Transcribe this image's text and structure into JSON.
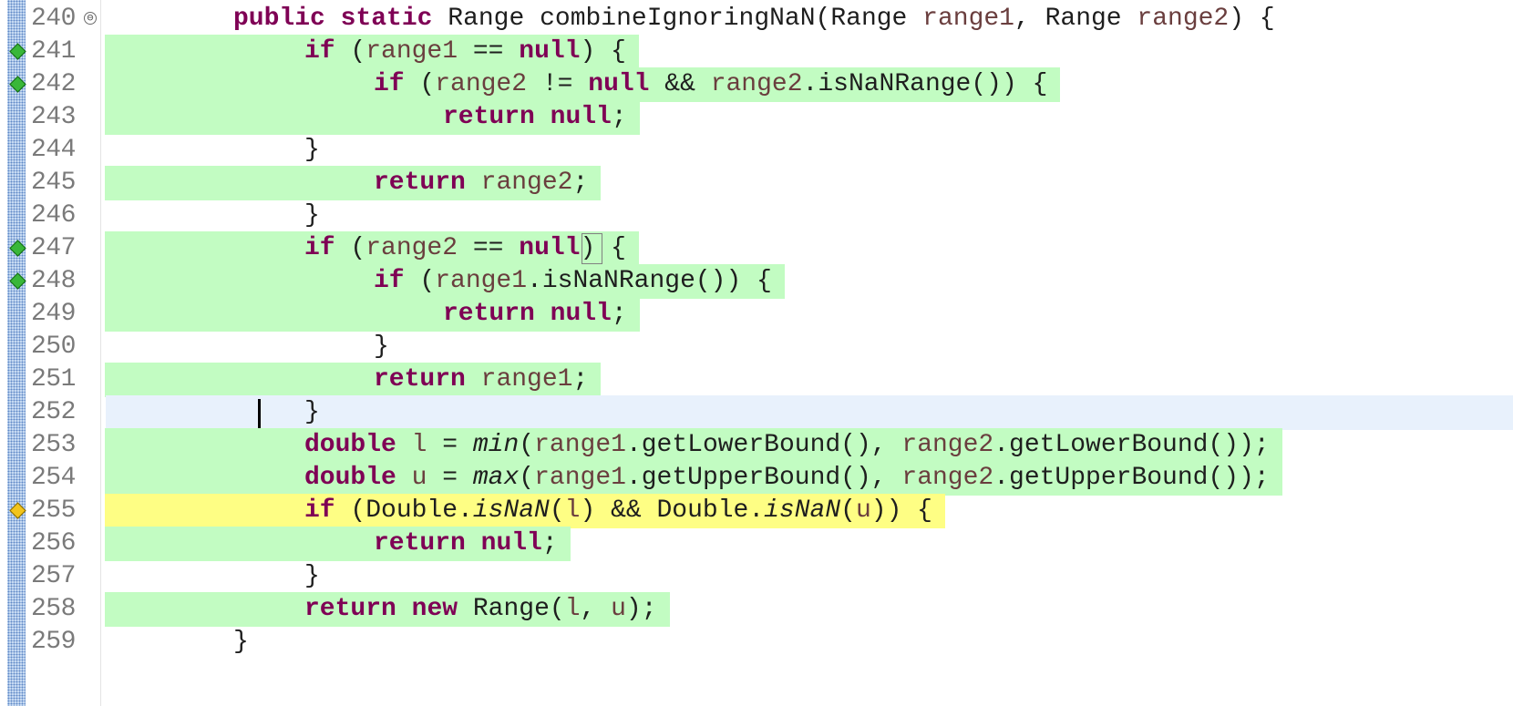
{
  "editor": {
    "lines": [
      {
        "number": "240",
        "fold": "⊖",
        "segments": [
          {
            "cls": "kw",
            "t": "public"
          },
          {
            "t": " "
          },
          {
            "cls": "kw",
            "t": "static"
          },
          {
            "t": " Range combineIgnoringNaN(Range "
          },
          {
            "cls": "par",
            "t": "range1"
          },
          {
            "t": ", Range "
          },
          {
            "cls": "par",
            "t": "range2"
          },
          {
            "t": ") {"
          }
        ]
      },
      {
        "number": "241",
        "marker": "covered",
        "highlight": "covered",
        "segments": [
          {
            "cls": "kw",
            "t": "if"
          },
          {
            "t": " ("
          },
          {
            "cls": "par",
            "t": "range1"
          },
          {
            "t": " == "
          },
          {
            "cls": "kw",
            "t": "null"
          },
          {
            "t": ") {"
          }
        ]
      },
      {
        "number": "242",
        "marker": "covered",
        "highlight": "covered",
        "segments": [
          {
            "cls": "kw",
            "t": "if"
          },
          {
            "t": " ("
          },
          {
            "cls": "par",
            "t": "range2"
          },
          {
            "t": " != "
          },
          {
            "cls": "kw",
            "t": "null"
          },
          {
            "t": " && "
          },
          {
            "cls": "par",
            "t": "range2"
          },
          {
            "t": ".isNaNRange()) {"
          }
        ]
      },
      {
        "number": "243",
        "highlight": "covered",
        "segments": [
          {
            "cls": "kw",
            "t": "return"
          },
          {
            "t": " "
          },
          {
            "cls": "kw",
            "t": "null"
          },
          {
            "t": ";"
          }
        ]
      },
      {
        "number": "244",
        "segments": [
          {
            "t": "}"
          }
        ]
      },
      {
        "number": "245",
        "highlight": "covered",
        "segments": [
          {
            "cls": "kw",
            "t": "return"
          },
          {
            "t": " "
          },
          {
            "cls": "par",
            "t": "range2"
          },
          {
            "t": ";"
          }
        ]
      },
      {
        "number": "246",
        "segments": [
          {
            "t": "}"
          }
        ]
      },
      {
        "number": "247",
        "marker": "covered",
        "highlight": "covered",
        "segments": [
          {
            "cls": "kw",
            "t": "if"
          },
          {
            "t": " ("
          },
          {
            "cls": "par",
            "t": "range2"
          },
          {
            "t": " == "
          },
          {
            "cls": "kw",
            "t": "null"
          },
          {
            "t": ") {"
          }
        ]
      },
      {
        "number": "248",
        "marker": "covered",
        "highlight": "covered",
        "segments": [
          {
            "cls": "kw",
            "t": "if"
          },
          {
            "t": " ("
          },
          {
            "cls": "par",
            "t": "range1"
          },
          {
            "t": ".isNaNRange()) {"
          }
        ]
      },
      {
        "number": "249",
        "highlight": "covered",
        "segments": [
          {
            "cls": "kw",
            "t": "return"
          },
          {
            "t": " "
          },
          {
            "cls": "kw",
            "t": "null"
          },
          {
            "t": ";"
          }
        ]
      },
      {
        "number": "250",
        "segments": [
          {
            "t": "}"
          }
        ]
      },
      {
        "number": "251",
        "highlight": "covered",
        "segments": [
          {
            "cls": "kw",
            "t": "return"
          },
          {
            "t": " "
          },
          {
            "cls": "par",
            "t": "range1"
          },
          {
            "t": ";"
          }
        ]
      },
      {
        "number": "252",
        "current": true,
        "segments": [
          {
            "t": "}"
          }
        ]
      },
      {
        "number": "253",
        "highlight": "covered",
        "segments": [
          {
            "cls": "kw",
            "t": "double"
          },
          {
            "t": " "
          },
          {
            "cls": "par",
            "t": "l"
          },
          {
            "t": " = "
          },
          {
            "cls": "st",
            "t": "min"
          },
          {
            "t": "("
          },
          {
            "cls": "par",
            "t": "range1"
          },
          {
            "t": ".getLowerBound(), "
          },
          {
            "cls": "par",
            "t": "range2"
          },
          {
            "t": ".getLowerBound());"
          }
        ]
      },
      {
        "number": "254",
        "highlight": "covered",
        "segments": [
          {
            "cls": "kw",
            "t": "double"
          },
          {
            "t": " "
          },
          {
            "cls": "par",
            "t": "u"
          },
          {
            "t": " = "
          },
          {
            "cls": "st",
            "t": "max"
          },
          {
            "t": "("
          },
          {
            "cls": "par",
            "t": "range1"
          },
          {
            "t": ".getUpperBound(), "
          },
          {
            "cls": "par",
            "t": "range2"
          },
          {
            "t": ".getUpperBound());"
          }
        ]
      },
      {
        "number": "255",
        "marker": "partial",
        "highlight": "partial",
        "segments": [
          {
            "cls": "kw",
            "t": "if"
          },
          {
            "t": " (Double."
          },
          {
            "cls": "st",
            "t": "isNaN"
          },
          {
            "t": "("
          },
          {
            "cls": "par",
            "t": "l"
          },
          {
            "t": ") && Double."
          },
          {
            "cls": "st",
            "t": "isNaN"
          },
          {
            "t": "("
          },
          {
            "cls": "par",
            "t": "u"
          },
          {
            "t": ")) {"
          }
        ]
      },
      {
        "number": "256",
        "highlight": "covered",
        "segments": [
          {
            "cls": "kw",
            "t": "return"
          },
          {
            "t": " "
          },
          {
            "cls": "kw",
            "t": "null"
          },
          {
            "t": ";"
          }
        ]
      },
      {
        "number": "257",
        "segments": [
          {
            "t": "}"
          }
        ]
      },
      {
        "number": "258",
        "highlight": "covered",
        "segments": [
          {
            "cls": "kw",
            "t": "return"
          },
          {
            "t": " "
          },
          {
            "cls": "kw",
            "t": "new"
          },
          {
            "t": " Range("
          },
          {
            "cls": "par",
            "t": "l"
          },
          {
            "t": ", "
          },
          {
            "cls": "par",
            "t": "u"
          },
          {
            "t": ");"
          }
        ]
      },
      {
        "number": "259",
        "segments": [
          {
            "t": "}"
          }
        ]
      }
    ]
  },
  "colors": {
    "covered": "#c2fcc2",
    "partial": "#fefe84",
    "current_line": "#e8f1fc",
    "keyword": "#7f0055",
    "parameter": "#6a3e3e"
  },
  "icons": {
    "covered_marker": "green-diamond-icon",
    "partial_marker": "yellow-diamond-icon",
    "fold": "collapse-circle-icon"
  }
}
